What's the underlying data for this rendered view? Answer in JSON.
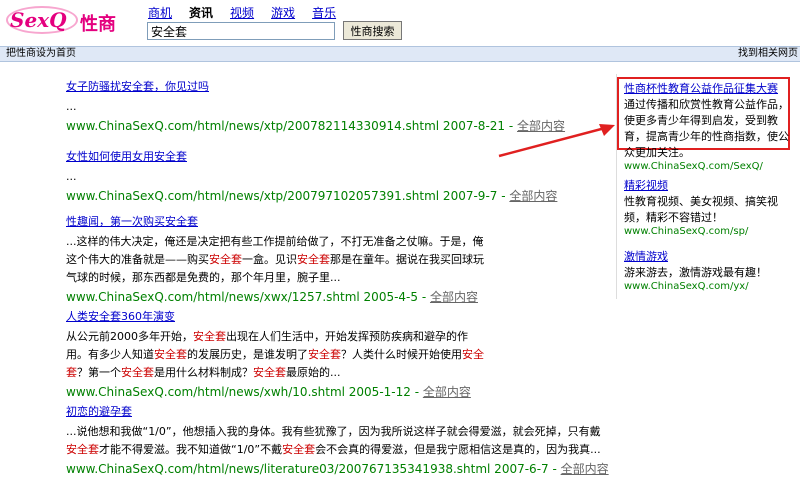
{
  "header": {
    "logo_text": "SexQ",
    "logo_cn": "性商",
    "nav": [
      "商机",
      "资讯",
      "视频",
      "游戏",
      "音乐"
    ],
    "nav_current_index": 1,
    "search_value": "安全套",
    "search_button": "性商搜索",
    "set_home": "把性商设为首页",
    "right_link": "找到相关网页"
  },
  "results": [
    {
      "title": "女子防骚扰安全套，你见过吗",
      "snippet": [
        {
          "t": "..."
        }
      ],
      "url": "www.ChinaSexQ.com/html/news/xtp/200782114330914.shtml 2007-8-21",
      "more": "全部内容"
    },
    {
      "title": "女性如何使用女用安全套",
      "snippet": [
        {
          "t": "..."
        }
      ],
      "url": "www.ChinaSexQ.com/html/news/xtp/200797102057391.shtml 2007-9-7",
      "more": "全部内容"
    },
    {
      "title": "性趣闻，第一次购买安全套",
      "snippet": [
        {
          "t": "...这样的伟大决定，俺还是决定把有些工作提前给做了，不打无准备之仗嘛。于是，俺这个伟大的准备就是——购买"
        },
        {
          "t": "安全套",
          "k": true
        },
        {
          "t": "一盒。见识"
        },
        {
          "t": "安全套",
          "k": true
        },
        {
          "t": "那是在童年。据说在我买回球玩气球的时候，那东西都是免费的，那个年月里，腕子里..."
        }
      ],
      "url": "www.ChinaSexQ.com/html/news/xwx/1257.shtml 2005-4-5",
      "more": "全部内容"
    },
    {
      "title": "人类安全套360年演变",
      "snippet": [
        {
          "t": "从公元前2000多年开始，"
        },
        {
          "t": "安全套",
          "k": true
        },
        {
          "t": "出现在人们生活中，开始发挥预防疾病和避孕的作用。有多少人知道"
        },
        {
          "t": "安全套",
          "k": true
        },
        {
          "t": "的发展历史，是谁发明了"
        },
        {
          "t": "安全套",
          "k": true
        },
        {
          "t": "？人类什么时候开始使用"
        },
        {
          "t": "安全套",
          "k": true
        },
        {
          "t": "？第一个"
        },
        {
          "t": "安全套",
          "k": true
        },
        {
          "t": "是用什么材料制成？"
        },
        {
          "t": "安全套",
          "k": true
        },
        {
          "t": "最原始的..."
        }
      ],
      "url": "www.ChinaSexQ.com/html/news/xwh/10.shtml 2005-1-12",
      "more": "全部内容"
    },
    {
      "title": "初恋的避孕套",
      "snippet": [
        {
          "t": "...说他想和我做“1/0”，他想插入我的身体。我有些犹豫了，因为我所说这样子就会得爱滋，就会死掉，只有戴"
        },
        {
          "t": "安全套",
          "k": true
        },
        {
          "t": "才能不得爱滋。我不知道做“1/0”不戴"
        },
        {
          "t": "安全套",
          "k": true
        },
        {
          "t": "会不会真的得爱滋，但是我宁愿相信这是真的，因为我真..."
        }
      ],
      "url": "www.ChinaSexQ.com/html/news/literature03/200767135341938.shtml 2007-6-7",
      "more": "全部内容"
    }
  ],
  "sidebar": [
    {
      "title": "性商杯性教育公益作品征集大赛",
      "desc": "通过传播和欣赏性教育公益作品，使更多青少年得到启发，受到教育，提高青少年的性商指数，使公众更加关注。",
      "url": "www.ChinaSexQ.com/SexQ/"
    },
    {
      "title": "精彩视频",
      "desc": "性教育视频、美女视频、搞笑视频，精彩不容错过！",
      "url": "www.ChinaSexQ.com/sp/"
    },
    {
      "title": "激情游戏",
      "desc": "游来游去，激情游戏最有趣！",
      "url": "www.ChinaSexQ.com/yx/"
    }
  ],
  "colors": {
    "link": "#0000cc",
    "url_green": "#008000",
    "keyword_red": "#cc0000",
    "highlight_box": "#e02020",
    "bar_bg": "#dfe8f6"
  }
}
